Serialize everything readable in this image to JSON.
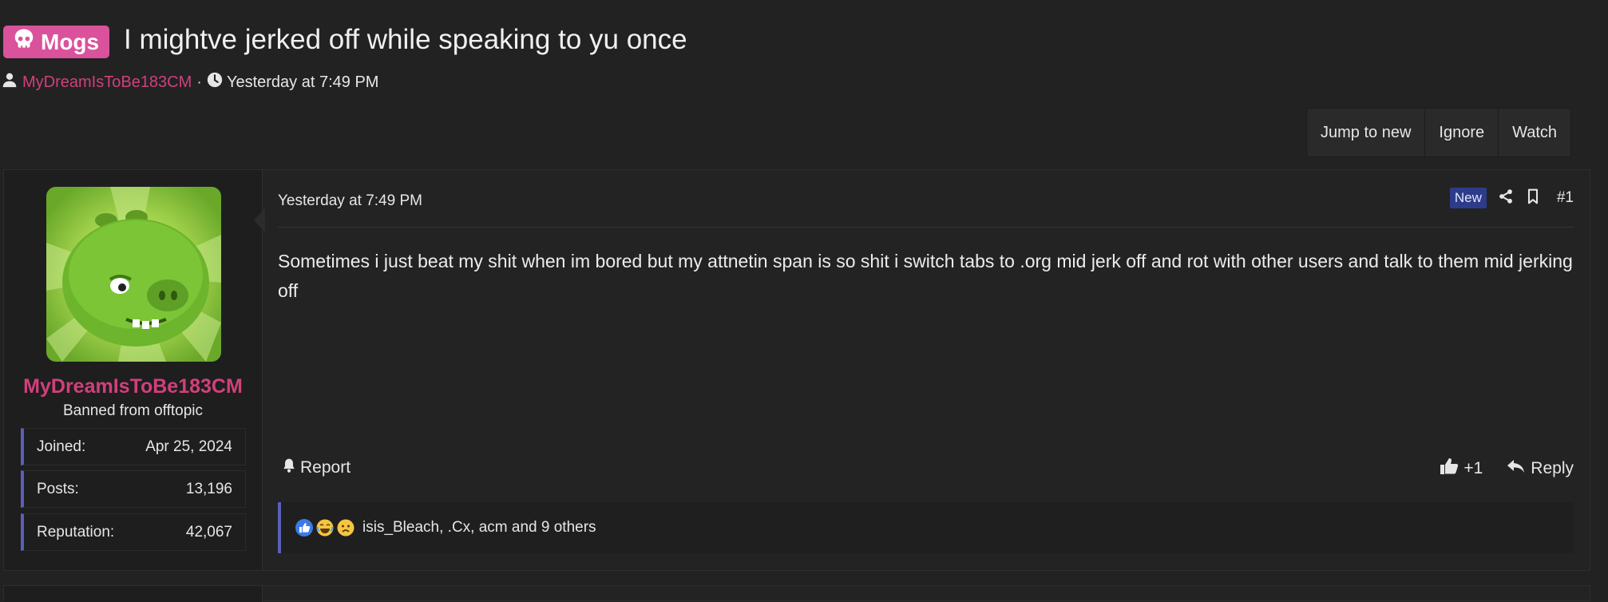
{
  "thread": {
    "prefix": "Mogs",
    "title": "I mightve jerked off while speaking to yu once",
    "author": "MyDreamIsToBe183CM",
    "separator": "·",
    "time": "Yesterday at 7:49 PM"
  },
  "thread_actions": {
    "jump_to_new": "Jump to new",
    "ignore": "Ignore",
    "watch": "Watch"
  },
  "post": {
    "user": {
      "name": "MyDreamIsToBe183CM",
      "title": "Banned from offtopic",
      "stats": [
        {
          "label": "Joined:",
          "value": "Apr 25, 2024"
        },
        {
          "label": "Posts:",
          "value": "13,196"
        },
        {
          "label": "Reputation:",
          "value": "42,067"
        }
      ]
    },
    "date": "Yesterday at 7:49 PM",
    "badge": "New",
    "number": "#1",
    "body": "Sometimes i just beat my shit when im bored but my attnetin span is so shit i switch tabs to .org mid jerk off and rot with other users and talk to them mid jerking off",
    "report_label": "Report",
    "like_count": "+1",
    "reply_label": "Reply",
    "reactions_text": "isis_Bleach, .Cx, acm and 9 others"
  },
  "icons": {
    "prefix_icon": "skull-icon",
    "author_icon": "user-icon",
    "time_icon": "clock-icon",
    "share_icon": "share-icon",
    "bookmark_icon": "bookmark-icon",
    "report_icon": "bell-icon",
    "like_icon": "thumbs-up-icon",
    "reply_icon": "reply-icon",
    "reaction_icons": [
      "like-reaction-icon",
      "laugh-cry-reaction-icon",
      "sad-reaction-icon"
    ]
  },
  "colors": {
    "background": "#222223",
    "prefix_bg": "#d9529b",
    "username": "#d1407a",
    "accent_border": "#5a5fb8",
    "new_badge": "#2c3c8a"
  }
}
